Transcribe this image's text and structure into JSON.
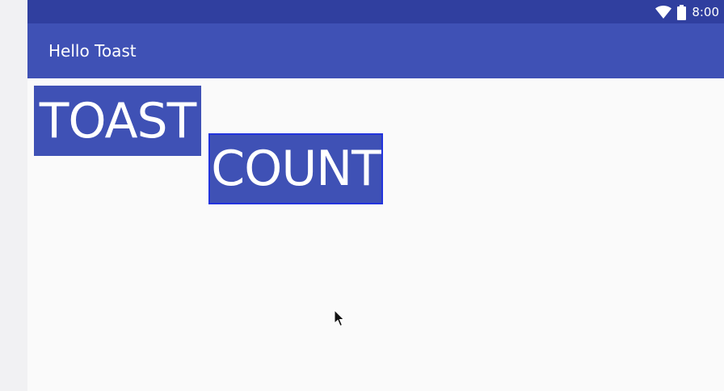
{
  "status_bar": {
    "time": "8:00",
    "icons": [
      "wifi-icon",
      "battery-icon"
    ],
    "background": "#303f9f"
  },
  "app_bar": {
    "title": "Hello Toast",
    "background": "#3f51b5"
  },
  "buttons": {
    "toast_label": "TOAST",
    "count_label": "COUNT",
    "background": "#3f51b5",
    "text_color": "#ffffff",
    "focus_outline": "#2233dd"
  },
  "content": {
    "background": "#fafafa"
  },
  "pointer": "cursor-arrow-icon"
}
